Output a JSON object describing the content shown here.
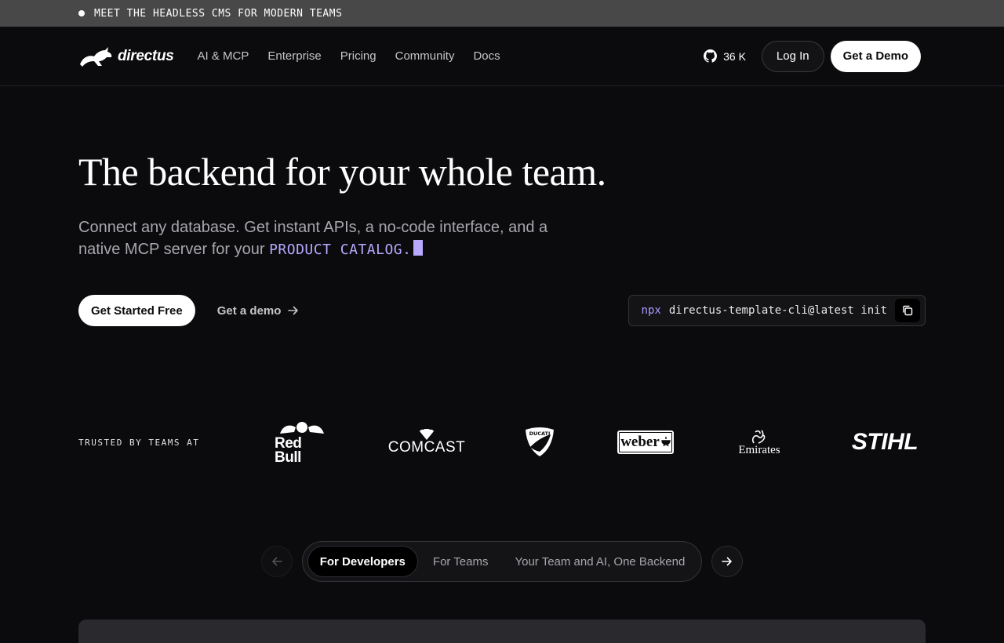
{
  "announcement": {
    "text": "MEET THE HEADLESS CMS FOR MODERN TEAMS"
  },
  "nav": {
    "logo_text": "directus",
    "links": [
      "AI & MCP",
      "Enterprise",
      "Pricing",
      "Community",
      "Docs"
    ],
    "github_stars": "36 K",
    "login_label": "Log In",
    "demo_label": "Get a Demo"
  },
  "hero": {
    "title": "The backend for your whole team.",
    "subtitle_line1": "Connect any database. Get instant APIs, a no-code interface, and a",
    "subtitle_line2": "native MCP server for your",
    "highlight": "PRODUCT CATALOG.",
    "primary_cta": "Get Started Free",
    "secondary_cta": "Get a demo",
    "cli_prefix": "npx",
    "cli_command": "directus-template-cli@latest init"
  },
  "trusted": {
    "label": "TRUSTED BY TEAMS AT",
    "brands": [
      "Red Bull",
      "COMCAST",
      "DUCATI",
      "weber",
      "Emirates",
      "STIHL"
    ]
  },
  "tabs": {
    "items": [
      "For Developers",
      "For Teams",
      "Your Team and AI, One Backend"
    ],
    "active_index": 0
  },
  "colors": {
    "accent": "#b8a8ff",
    "background": "#0b0a0c",
    "banner": "#484848"
  }
}
